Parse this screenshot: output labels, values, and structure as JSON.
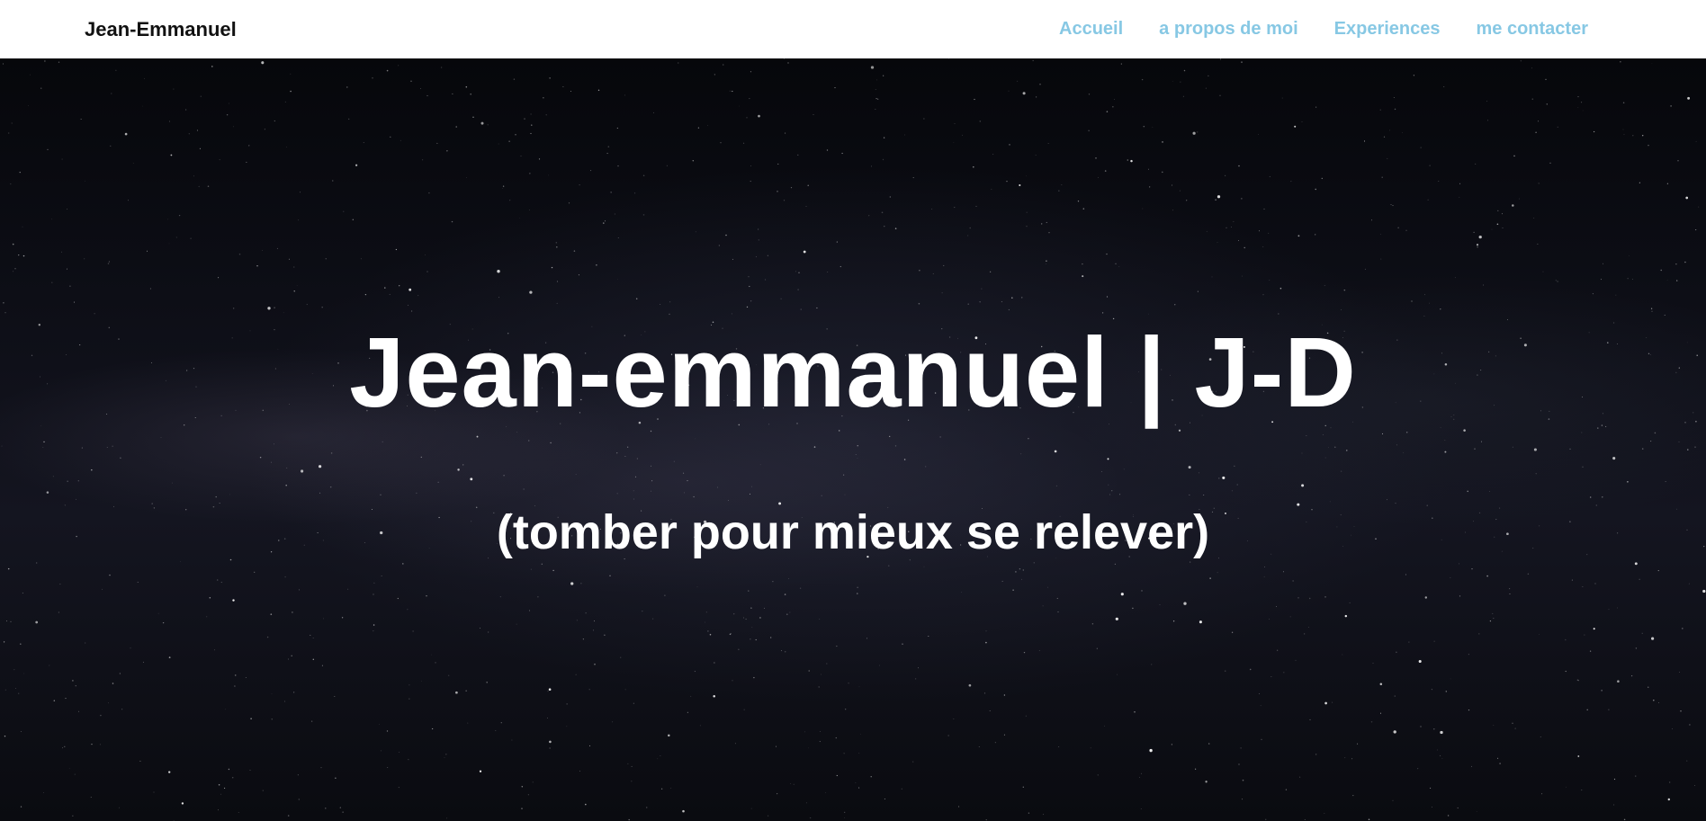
{
  "navbar": {
    "brand": "Jean-Emmanuel",
    "links": [
      {
        "label": "Accueil"
      },
      {
        "label": "a propos de moi"
      },
      {
        "label": "Experiences"
      },
      {
        "label": "me contacter"
      }
    ],
    "link_color": "#87c8e4"
  },
  "hero": {
    "title": "Jean-emmanuel | J-D",
    "subtitle": "(tomber pour mieux se relever)",
    "background": "starry night sky"
  }
}
